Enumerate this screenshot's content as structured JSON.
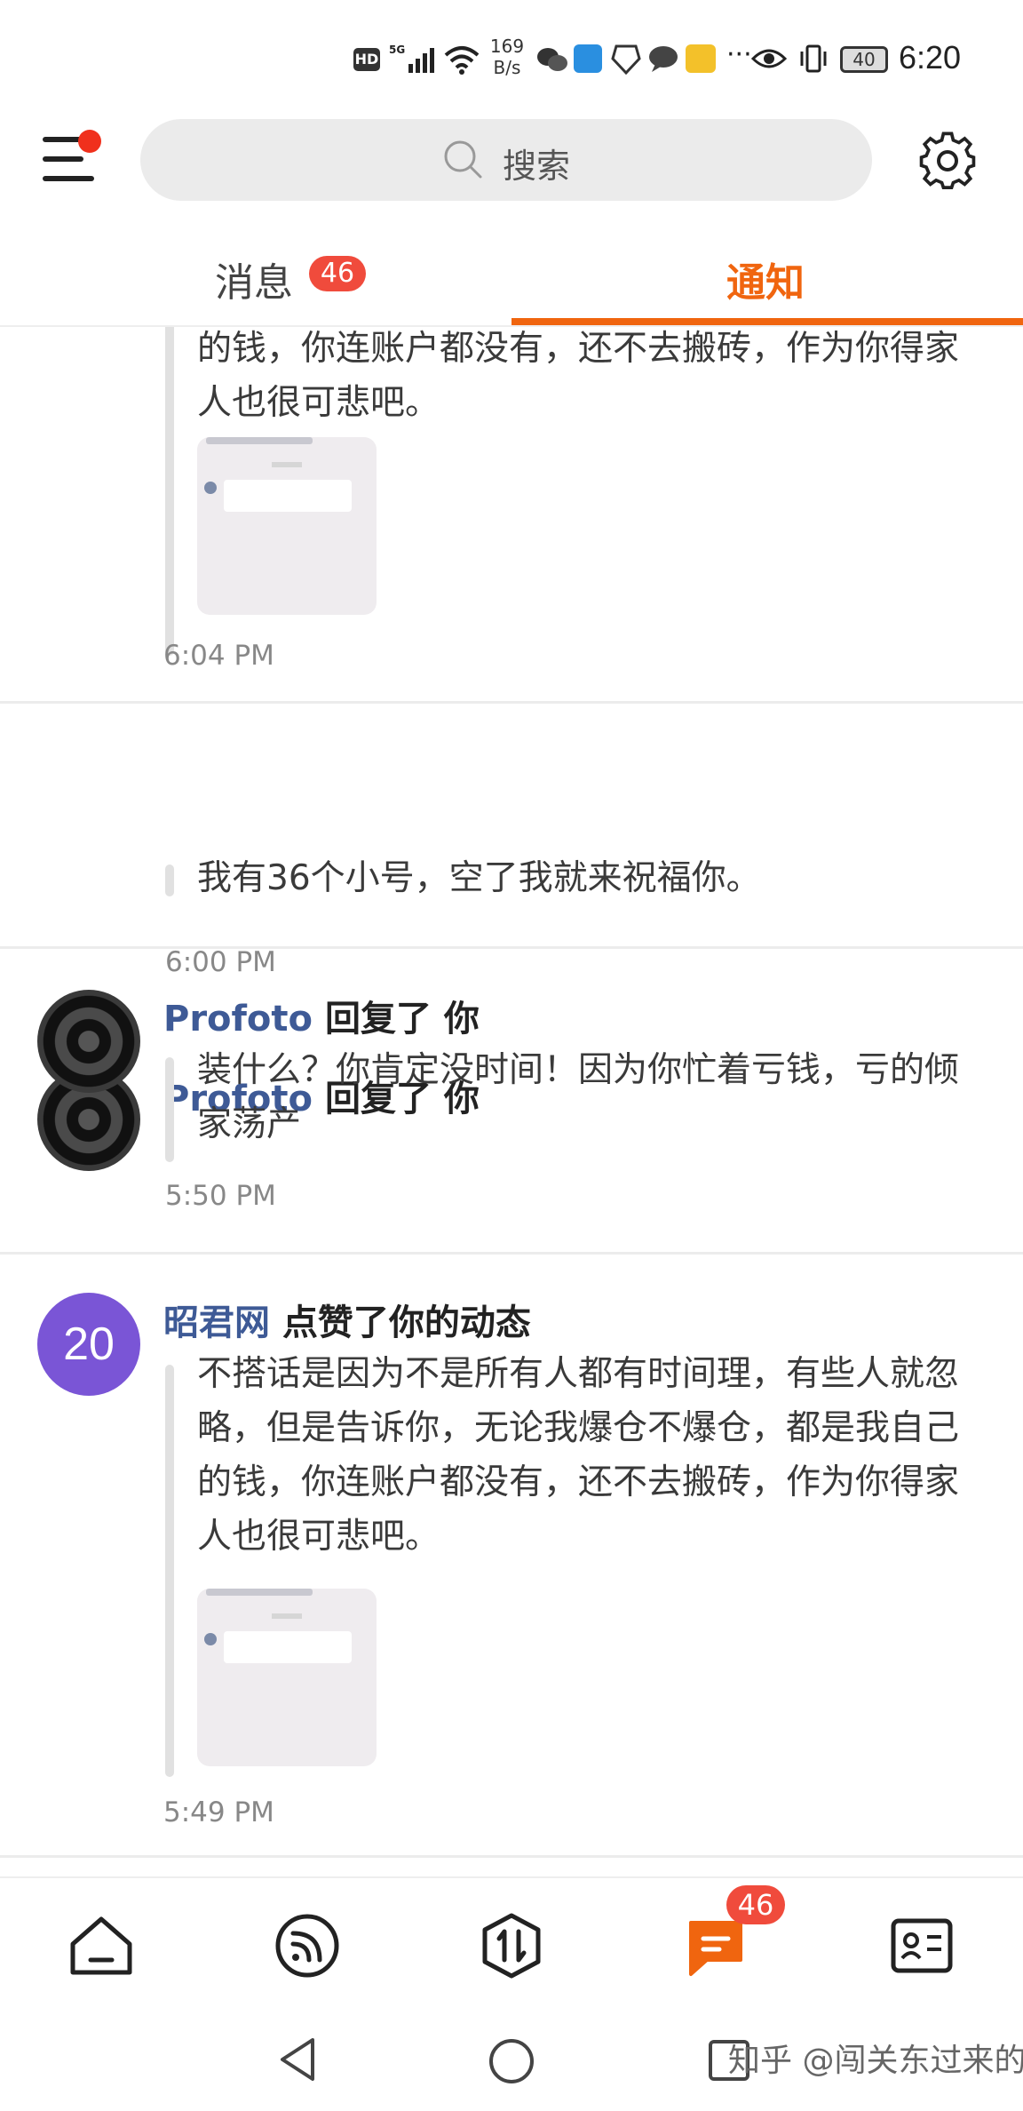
{
  "status_bar": {
    "hd": "HD",
    "network": "5G",
    "speed_value": "169",
    "speed_unit": "B/s",
    "battery": "40",
    "time": "6:20"
  },
  "header": {
    "search_placeholder": "搜索"
  },
  "tabs": {
    "messages_label": "消息",
    "messages_badge": "46",
    "notify_label": "通知",
    "active": "通知"
  },
  "feed": [
    {
      "quote": "的钱，你连账户都没有，还不去搬砖，作为你得家人也很可悲吧。",
      "has_image": true,
      "time": "6:04 PM"
    },
    {
      "avatar": "shield",
      "user": "Profoto",
      "action": "回复了 你",
      "quote": "我有36个小号，空了我就来祝福你。",
      "time": "6:00 PM"
    },
    {
      "avatar": "shield",
      "user": "Profoto",
      "action": "回复了 你",
      "quote": "装什么？你肯定没时间！因为你忙着亏钱，亏的倾家荡产",
      "time": "5:50 PM"
    },
    {
      "avatar": "number",
      "avatar_text": "20",
      "avatar_color": "#7a55d6",
      "user": "昭君网",
      "action": "点赞了你的动态",
      "quote": "不搭话是因为不是所有人都有时间理，有些人就忽略，但是告诉你，无论我爆仓不爆仓，都是我自己的钱，你连账户都没有，还不去搬砖，作为你得家人也很可悲吧。",
      "has_image": true,
      "time": "5:49 PM"
    }
  ],
  "bottom_nav": {
    "items": [
      "home-icon",
      "feed-icon",
      "trade-icon",
      "messages-icon",
      "profile-icon"
    ],
    "active": "messages-icon",
    "messages_badge": "46"
  },
  "watermark": "知乎 @闯关东过来的",
  "colors": {
    "accent": "#f0650f",
    "badge": "#f04b3c",
    "username": "#3e5a96"
  }
}
